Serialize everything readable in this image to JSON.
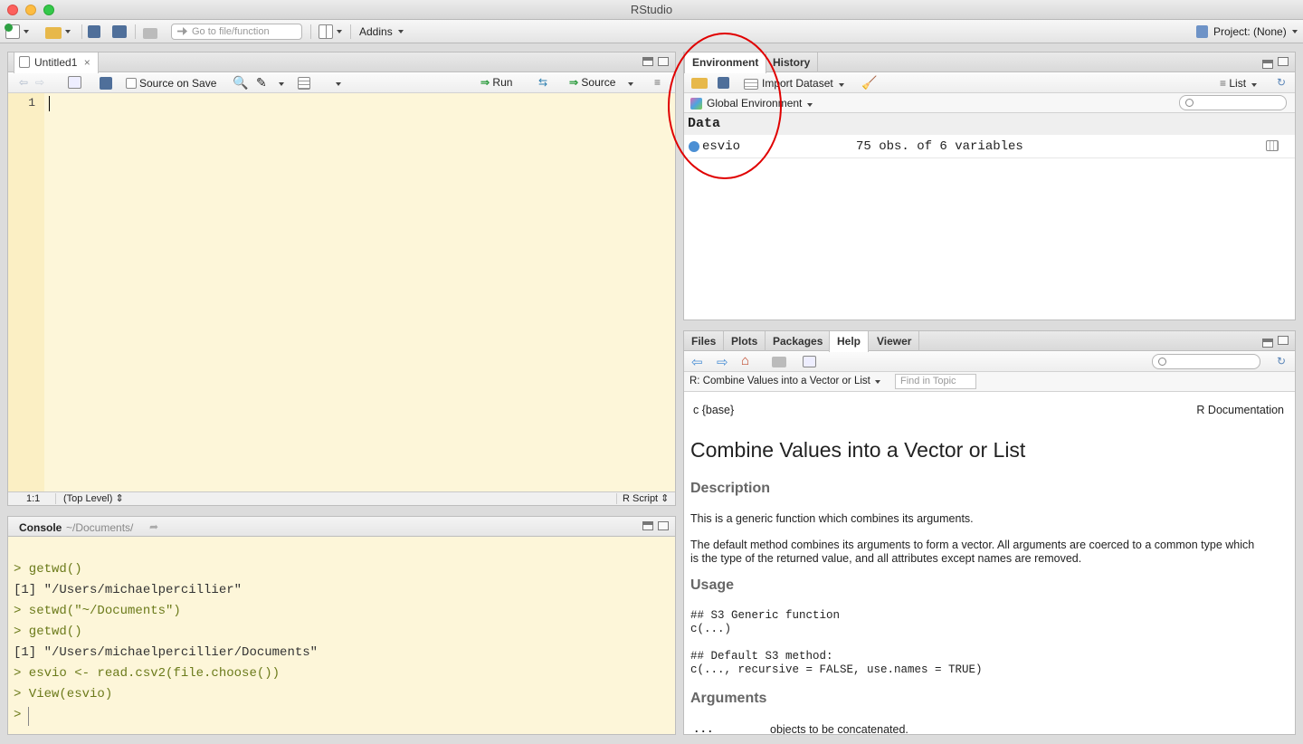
{
  "window": {
    "title": "RStudio"
  },
  "toolbar": {
    "goto_placeholder": "Go to file/function",
    "addins_label": "Addins",
    "project_label": "Project: (None)"
  },
  "editor": {
    "tab_label": "Untitled1",
    "source_on_save": "Source on Save",
    "run_label": "Run",
    "source_label": "Source",
    "line_number": "1",
    "status_position": "1:1",
    "status_scope": "(Top Level)",
    "status_type": "R Script"
  },
  "console": {
    "title": "Console",
    "path": "~/Documents/",
    "lines": [
      {
        "text": "> getwd()",
        "kind": "cmd"
      },
      {
        "text": "[1] \"/Users/michaelpercillier\"",
        "kind": "out"
      },
      {
        "text": "> setwd(\"~/Documents\")",
        "kind": "cmd"
      },
      {
        "text": "> getwd()",
        "kind": "cmd"
      },
      {
        "text": "[1] \"/Users/michaelpercillier/Documents\"",
        "kind": "out"
      },
      {
        "text": "> esvio <- read.csv2(file.choose())",
        "kind": "cmd"
      },
      {
        "text": "> View(esvio)",
        "kind": "cmd"
      },
      {
        "text": ">",
        "kind": "cmd"
      }
    ]
  },
  "environment": {
    "tabs": [
      "Environment",
      "History"
    ],
    "import_dataset": "Import Dataset",
    "list_label": "List",
    "scope": "Global Environment",
    "section": "Data",
    "rows": [
      {
        "name": "esvio",
        "value": "75 obs. of 6 variables"
      }
    ]
  },
  "help": {
    "tabs": [
      "Files",
      "Plots",
      "Packages",
      "Help",
      "Viewer"
    ],
    "topic": "R: Combine Values into a Vector or List",
    "find_placeholder": "Find in Topic",
    "pkg": "c {base}",
    "rdoc": "R Documentation",
    "title": "Combine Values into a Vector or List",
    "description_h": "Description",
    "desc1": "This is a generic function which combines its arguments.",
    "desc2a": "The default method combines its arguments to form a vector. All arguments are coerced to a common type which",
    "desc2b": "is the type of the returned value, and all attributes except names are removed.",
    "usage_h": "Usage",
    "usage1": "## S3 Generic function",
    "usage2": "c(...)",
    "usage3": "## Default S3 method:",
    "usage4": "c(..., recursive = FALSE, use.names = TRUE)",
    "arguments_h": "Arguments",
    "arg_name": "...",
    "arg_desc": "objects to be concatenated."
  }
}
